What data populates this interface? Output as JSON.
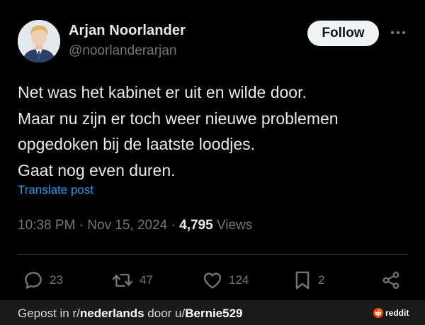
{
  "author": {
    "display_name": "Arjan Noorlander",
    "handle": "@noorlanderarjan"
  },
  "follow_label": "Follow",
  "post": {
    "lines": [
      "Net was het kabinet er uit en wilde door.",
      "Maar nu zijn er toch weer nieuwe problemen",
      "opgedoken bij de laatste loodjes.",
      "Gaat nog even duren."
    ],
    "translate_label": "Translate post"
  },
  "meta": {
    "time": "10:38 PM",
    "separator": "·",
    "date": "Nov 15, 2024",
    "views_count": "4,795",
    "views_label": "Views"
  },
  "actions": {
    "replies": "23",
    "reposts": "47",
    "likes": "124",
    "bookmarks": "2"
  },
  "footer": {
    "prefix": "Gepost in r/",
    "subreddit": "nederlands",
    "middle": " door u/",
    "user": "Bernie529",
    "brand": "reddit"
  },
  "colors": {
    "background": "#000000",
    "text": "#e7e9ea",
    "secondary": "#71767b",
    "link": "#1d9bf0",
    "footer_bg": "#1a1a1b",
    "reddit_orange": "#ff4500"
  },
  "icons": {
    "more": "more-horizontal-icon",
    "reply": "reply-bubble-icon",
    "repost": "repost-icon",
    "like": "heart-icon",
    "bookmark": "bookmark-icon",
    "share": "share-icon",
    "reddit": "reddit-alien-icon"
  }
}
